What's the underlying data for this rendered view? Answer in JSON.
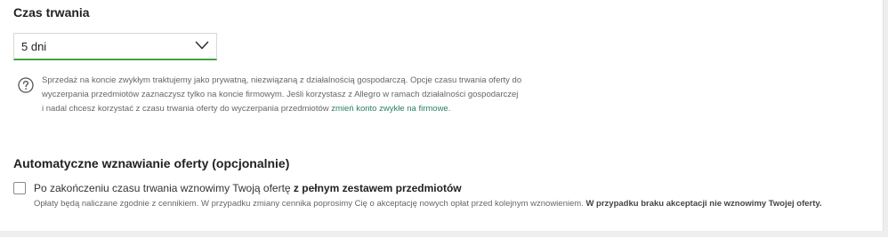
{
  "duration": {
    "title": "Czas trwania",
    "select_value": "5 dni",
    "info_text": "Sprzedaż na koncie zwykłym traktujemy jako prywatną, niezwiązaną z działalnością gospodarczą. Opcje czasu trwania oferty do wyczerpania przedmiotów zaznaczysz tylko na koncie firmowym. Jeśli korzystasz z Allegro w ramach działalności gospodarczej i nadal chcesz korzystać z czasu trwania oferty do wyczerpania przedmiotów ",
    "info_link": "zmień konto zwykłe na firmowe",
    "info_end": "."
  },
  "renewal": {
    "title": "Automatyczne wznawianie oferty (opcjonalnie)",
    "checkbox_label": "Po zakończeniu czasu trwania wznowimy Twoją ofertę ",
    "checkbox_label_bold": "z pełnym zestawem przedmiotów",
    "checked": false,
    "note": "Opłaty będą naliczane zgodnie z cennikiem. W przypadku zmiany cennika poprosimy Cię o akceptację nowych opłat przed kolejnym wznowieniem. ",
    "note_bold": "W przypadku braku akceptacji nie wznowimy Twojej oferty."
  },
  "colors": {
    "accent_green": "#43a047",
    "link_green": "#2a7f62"
  },
  "icons": {
    "help": "question-circle-icon",
    "dropdown": "chevron-down-icon"
  }
}
